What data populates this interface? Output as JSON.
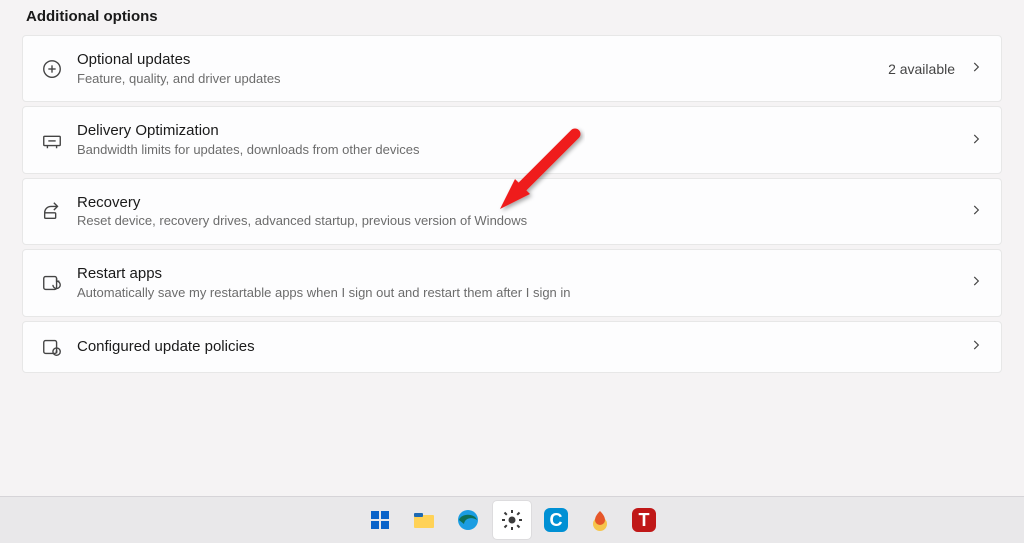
{
  "section": {
    "title": "Additional options"
  },
  "items": [
    {
      "icon": "plus-circle-icon",
      "title": "Optional updates",
      "subtitle": "Feature, quality, and driver updates",
      "right_text": "2 available"
    },
    {
      "icon": "delivery-icon",
      "title": "Delivery Optimization",
      "subtitle": "Bandwidth limits for updates, downloads from other devices",
      "right_text": ""
    },
    {
      "icon": "recovery-icon",
      "title": "Recovery",
      "subtitle": "Reset device, recovery drives, advanced startup, previous version of Windows",
      "right_text": ""
    },
    {
      "icon": "restart-apps-icon",
      "title": "Restart apps",
      "subtitle": "Automatically save my restartable apps when I sign out and restart them after I sign in",
      "right_text": ""
    },
    {
      "icon": "policies-icon",
      "title": "Configured update policies",
      "subtitle": "",
      "right_text": ""
    }
  ],
  "taskbar": {
    "items": [
      {
        "name": "start",
        "active": false
      },
      {
        "name": "file-explorer",
        "active": false
      },
      {
        "name": "edge",
        "active": false
      },
      {
        "name": "settings",
        "active": true
      },
      {
        "name": "app-c",
        "active": false
      },
      {
        "name": "app-flame",
        "active": false
      },
      {
        "name": "app-t",
        "active": false
      }
    ]
  },
  "annotation": {
    "arrow": "red-arrow"
  }
}
